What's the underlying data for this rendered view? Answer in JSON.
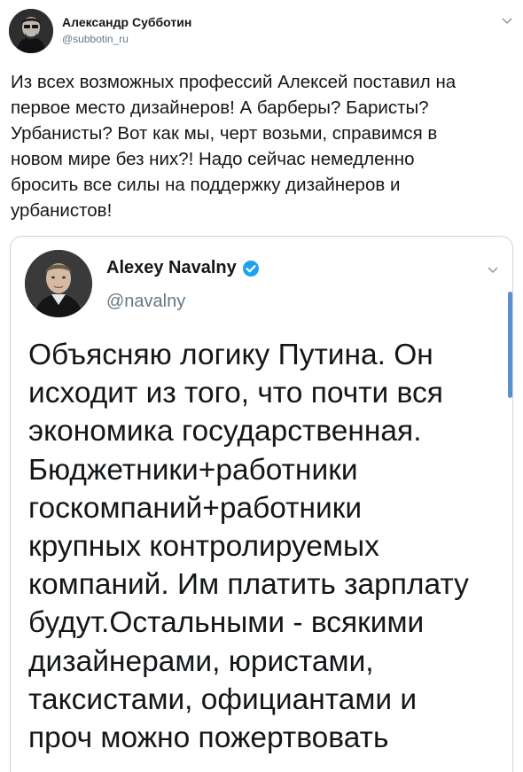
{
  "outer_tweet": {
    "author_name": "Александр Субботин",
    "handle": "@subbotin_ru",
    "avatar_icon": "person-portrait-avatar",
    "menu_icon": "chevron-down-icon",
    "text": "Из всех возможных профессий Алексей поставил на\nпервое место дизайнеров! А барберы? Баристы?\nУрбанисты? Вот как мы, черт возьми, справимся в\nновом мире без них?! Надо сейчас немедленно\nбросить все силы на поддержку дизайнеров и\nурбанистов!"
  },
  "quoted_tweet": {
    "author_name": "Alexey Navalny",
    "handle": "@navalny",
    "avatar_icon": "person-portrait-avatar",
    "verified_icon": "verified-badge-icon",
    "menu_icon": "chevron-down-icon",
    "text": "Объясняю логику Путина. Он\nисходит из того, что почти вся\nэкономика государственная.\nБюджетники+работники\nгоскомпаний+работники\nкрупных контролируемых\nкомпаний. Им платить зарплату\nбудут.Остальными - всякими\nдизайнерами, юристами,\nтаксистами, официантами и\nпроч можно пожертвовать"
  },
  "colors": {
    "text_primary": "#14171a",
    "text_secondary": "#657786",
    "verified_blue": "#1da1f2",
    "border": "#ccd6dd",
    "scrollbar": "#5a8fd0"
  }
}
